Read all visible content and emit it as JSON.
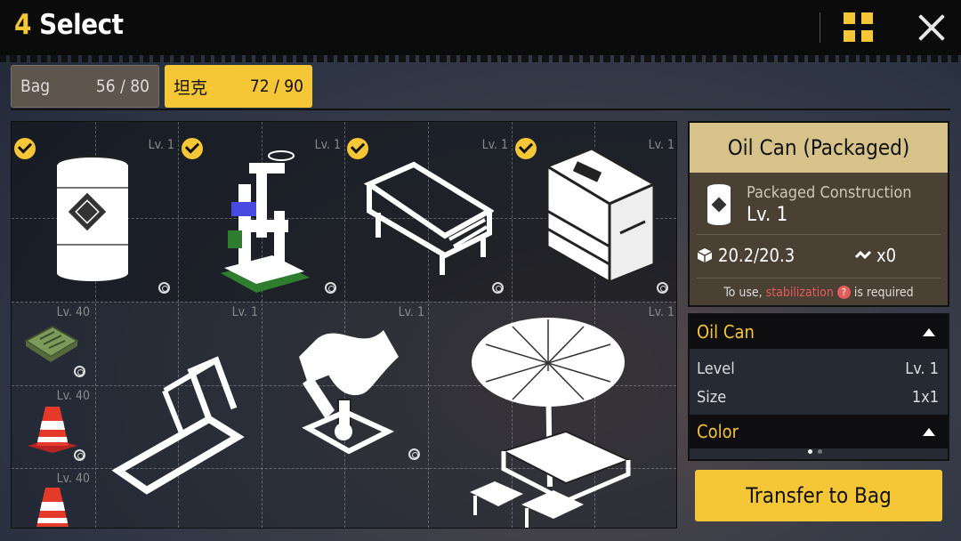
{
  "header": {
    "count": "4",
    "title": "Select"
  },
  "tabs": [
    {
      "name": "Bag",
      "count": "56 / 80",
      "active": false
    },
    {
      "name": "坦克",
      "count": "72 / 90",
      "active": true
    }
  ],
  "inventory": {
    "top_row": [
      {
        "name": "oil-can",
        "level": "Lv. 1",
        "selected": true
      },
      {
        "name": "cat-tree",
        "level": "Lv. 1",
        "selected": true
      },
      {
        "name": "bed",
        "level": "Lv. 1",
        "selected": true
      },
      {
        "name": "copier",
        "level": "Lv. 1",
        "selected": true
      }
    ],
    "lower": [
      {
        "name": "mat",
        "level": "Lv. 40"
      },
      {
        "name": "traffic-cone",
        "level": "Lv. 40"
      },
      {
        "name": "traffic-cone",
        "level": "Lv. 40"
      },
      {
        "name": "treadmill",
        "level": "Lv. 1"
      },
      {
        "name": "spring-rider",
        "level": "Lv. 1"
      },
      {
        "name": "umbrella-table",
        "level": "Lv. 1"
      }
    ]
  },
  "detail": {
    "title": "Oil Can (Packaged)",
    "subtitle": "Packaged Construction",
    "level": "Lv. 1",
    "weight": "20.2/20.3",
    "stack": "x0",
    "note_prefix": "To use,",
    "note_warn": "stabilization",
    "note_suffix": "is required",
    "qmark": "?"
  },
  "props": {
    "section1": "Oil Can",
    "level_label": "Level",
    "level_value": "Lv. 1",
    "size_label": "Size",
    "size_value": "1x1",
    "section2": "Color"
  },
  "transfer_label": "Transfer to Bag",
  "colors": {
    "accent": "#f5c636",
    "warn": "#e35b5b"
  }
}
